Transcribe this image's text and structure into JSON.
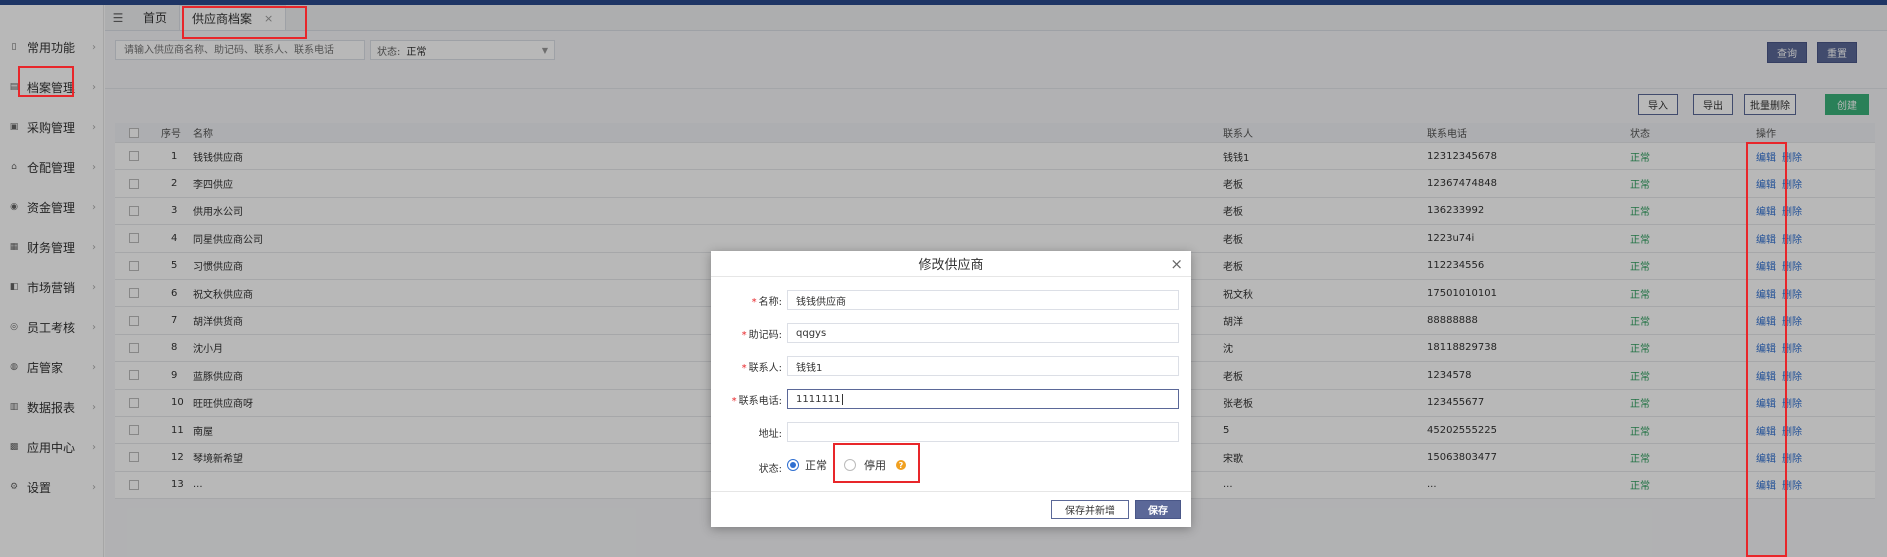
{
  "sidebar": {
    "items": [
      {
        "label": "常用功能",
        "icon": "doc-icon"
      },
      {
        "label": "档案管理",
        "icon": "archive-icon"
      },
      {
        "label": "采购管理",
        "icon": "cart-icon"
      },
      {
        "label": "仓配管理",
        "icon": "warehouse-icon"
      },
      {
        "label": "资金管理",
        "icon": "money-icon"
      },
      {
        "label": "财务管理",
        "icon": "calculator-icon"
      },
      {
        "label": "市场营销",
        "icon": "megaphone-icon"
      },
      {
        "label": "员工考核",
        "icon": "people-icon"
      },
      {
        "label": "店管家",
        "icon": "store-icon"
      },
      {
        "label": "数据报表",
        "icon": "chart-icon"
      },
      {
        "label": "应用中心",
        "icon": "apps-icon"
      },
      {
        "label": "设置",
        "icon": "gear-icon"
      }
    ]
  },
  "tabs": {
    "home": "首页",
    "active": "供应商档案",
    "close": "×"
  },
  "filter": {
    "search_placeholder": "请输入供应商名称、助记码、联系人、联系电话",
    "status_label": "状态:",
    "status_value": "正常",
    "query": "查询",
    "reset": "重置"
  },
  "toolbar": {
    "import": "导入",
    "export": "导出",
    "batch_delete": "批量删除",
    "create": "创建"
  },
  "table": {
    "headers": {
      "index": "序号",
      "name": "名称",
      "contact": "联系人",
      "phone": "联系电话",
      "status": "状态",
      "ops": "操作"
    },
    "edit": "编辑",
    "delete": "删除",
    "rows": [
      {
        "index": "1",
        "name": "钱钱供应商",
        "contact": "钱钱1",
        "phone": "12312345678",
        "status": "正常"
      },
      {
        "index": "2",
        "name": "李四供应",
        "contact": "老板",
        "phone": "12367474848",
        "status": "正常"
      },
      {
        "index": "3",
        "name": "供用水公司",
        "contact": "老板",
        "phone": "136233992",
        "status": "正常"
      },
      {
        "index": "4",
        "name": "同星供应商公司",
        "contact": "老板",
        "phone": "1223u74i",
        "status": "正常"
      },
      {
        "index": "5",
        "name": "习惯供应商",
        "contact": "老板",
        "phone": "112234556",
        "status": "正常"
      },
      {
        "index": "6",
        "name": "祝文秋供应商",
        "contact": "祝文秋",
        "phone": "17501010101",
        "status": "正常"
      },
      {
        "index": "7",
        "name": "胡洋供货商",
        "contact": "胡洋",
        "phone": "88888888",
        "status": "正常"
      },
      {
        "index": "8",
        "name": "沈小月",
        "contact": "沈",
        "phone": "18118829738",
        "status": "正常"
      },
      {
        "index": "9",
        "name": "蓝豚供应商",
        "contact": "老板",
        "phone": "1234578",
        "status": "正常"
      },
      {
        "index": "10",
        "name": "旺旺供应商呀",
        "contact": "张老板",
        "phone": "123455677",
        "status": "正常"
      },
      {
        "index": "11",
        "name": "南屋",
        "contact": "5",
        "phone": "45202555225",
        "status": "正常"
      },
      {
        "index": "12",
        "name": "琴境新希望",
        "contact": "宋歌",
        "phone": "15063803477",
        "status": "正常"
      },
      {
        "index": "13",
        "name": "...",
        "contact": "...",
        "phone": "...",
        "status": "正常"
      }
    ]
  },
  "modal": {
    "title": "修改供应商",
    "close": "×",
    "fields": {
      "name_label": "名称:",
      "name_value": "钱钱供应商",
      "code_label": "助记码:",
      "code_value": "qqgys",
      "contact_label": "联系人:",
      "contact_value": "钱钱1",
      "phone_label": "联系电话:",
      "phone_value": "1111111",
      "address_label": "地址:",
      "address_value": "",
      "status_label": "状态:",
      "status_normal": "正常",
      "status_disabled": "停用",
      "required_mark": "*"
    },
    "save_and_new": "保存并新增",
    "save": "保存"
  }
}
